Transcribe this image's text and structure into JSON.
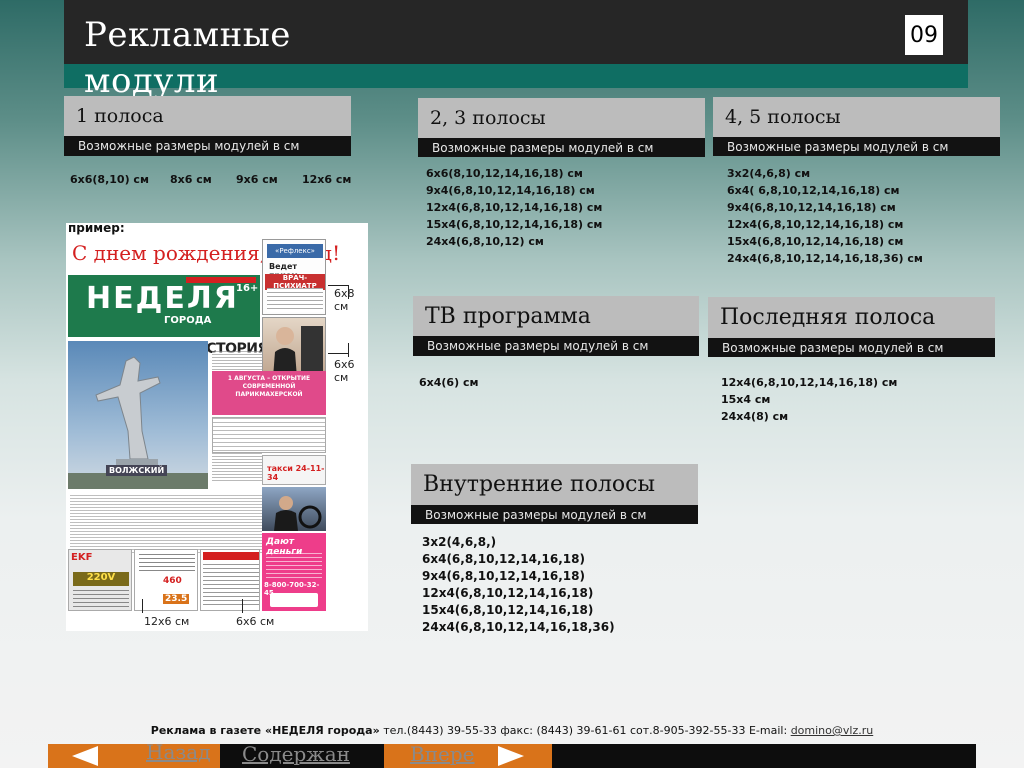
{
  "header": {
    "title_line1": "Рекламные",
    "title_line2": "модули",
    "page_number": "09"
  },
  "sections": {
    "page1": {
      "title": "1 полоса",
      "subtitle": "Возможные размеры модулей в см",
      "sizes": [
        "6х6(8,10) см",
        "8х6 см",
        "9х6 см",
        "12х6 см"
      ]
    },
    "page23": {
      "title": "2, 3 полосы",
      "subtitle": "Возможные размеры модулей в см",
      "sizes": [
        "6х6(8,10,12,14,16,18) см",
        "9х4(6,8,10,12,14,16,18) см",
        "12х4(6,8,10,12,14,16,18) см",
        "15х4(6,8,10,12,14,16,18) см",
        "24х4(6,8,10,12) см"
      ]
    },
    "page45": {
      "title": "4, 5 полосы",
      "subtitle": "Возможные размеры модулей в см",
      "sizes": [
        "3х2(4,6,8) см",
        "6х4( 6,8,10,12,14,16,18) см",
        "9х4(6,8,10,12,14,16,18) см",
        "12х4(6,8,10,12,14,16,18) см",
        "15х4(6,8,10,12,14,16,18) см",
        "24х4(6,8,10,12,14,16,18,36) см"
      ]
    },
    "tv": {
      "title": "ТВ программа",
      "subtitle": "Возможные размеры модулей в см",
      "sizes": [
        "6х4(6) см"
      ]
    },
    "last": {
      "title": "Последняя полоса",
      "subtitle": "Возможные размеры модулей в см",
      "sizes": [
        "12х4(6,8,10,12,14,16,18) см",
        "15х4 см",
        "24х4(8) см"
      ]
    },
    "inner": {
      "title": "Внутренние полосы",
      "subtitle": "Возможные размеры модулей в см",
      "sizes": [
        "3х2(4,6,8,)",
        "6х4(6,8,10,12,14,16,18)",
        "9х4(6,8,10,12,14,16,18)",
        "12х4(6,8,10,12,14,16,18)",
        "15х4(6,8,10,12,14,16,18)",
        "24х4(6,8,10,12,14,16,18,36)"
      ]
    }
  },
  "example": {
    "label": "пример:",
    "headline": "С днем рождения, город!",
    "masthead": "НЕДЕЛЯ",
    "masthead_sub": "ГОРОДА",
    "age": "16+",
    "story": "НАША ИСТОРИЯ",
    "stadium": "ВОЛЖСКИЙ",
    "ad_doctor_title": "Ведет прием",
    "ad_doctor_name": "ВРАЧ-ПСИХИАТР",
    "ad_reflex": "«Рефлекс»",
    "ad_pharmacy": "1 АВГУСТА – ОТКРЫТИЕ СОВРЕМЕННОЙ ПАРИКМАХЕРСКОЙ",
    "ad_taxi": "такси 24-11-34",
    "ad_money": "Дают деньги",
    "ad_money_phone": "8-800-700-32-45",
    "ad_ekf": "EKF",
    "ad_volt": "220V",
    "ad_price1": "460",
    "ad_price2": "23.5",
    "ann_right_top": "6х8 см",
    "ann_right_mid": "6х6 см",
    "ann_bottom_left": "12х6 см",
    "ann_bottom_right": "6х6 см"
  },
  "footer": {
    "text_prefix": "Реклама в газете «НЕДЕЛЯ города»",
    "text_contacts": " тел.(8443) 39-55-33  факс: (8443) 39-61-61  сот.8-905-392-55-33  E-mail: ",
    "email": "domino@vlz.ru"
  },
  "nav": {
    "back": "Назад",
    "contents": "Содержан",
    "forward": "Впере"
  },
  "colors": {
    "header_dark": "#262626",
    "header_teal": "#0f6e63",
    "nav_orange": "#d9731a",
    "newspaper_green": "#1e7a4c",
    "newspaper_red": "#d42020"
  }
}
